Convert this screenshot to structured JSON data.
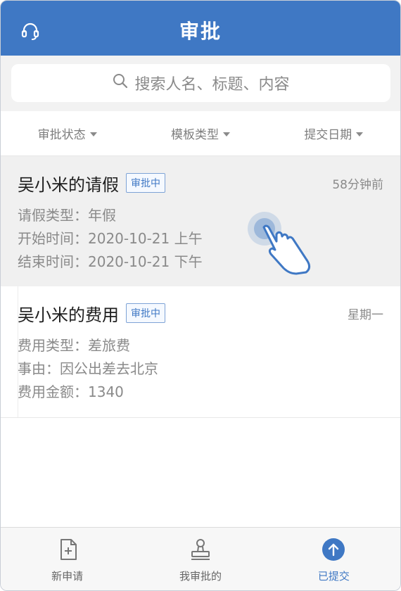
{
  "header": {
    "title": "审批",
    "support_icon": "headset-icon"
  },
  "search": {
    "placeholder": "搜索人名、标题、内容"
  },
  "filters": [
    {
      "label": "审批状态"
    },
    {
      "label": "模板类型"
    },
    {
      "label": "提交日期"
    }
  ],
  "cards": [
    {
      "title": "吴小米的请假",
      "badge": "审批中",
      "time": "58分钟前",
      "lines": [
        "请假类型：年假",
        "开始时间：2020-10-21 上午",
        "结束时间：2020-10-21 下午"
      ]
    },
    {
      "title": "吴小米的费用",
      "badge": "审批中",
      "time": "星期一",
      "lines": [
        "费用类型：差旅费",
        "事由：因公出差去北京",
        "费用金额：1340"
      ]
    }
  ],
  "tabs": [
    {
      "label": "新申请",
      "icon": "new-doc-icon",
      "active": false
    },
    {
      "label": "我审批的",
      "icon": "stamp-icon",
      "active": false
    },
    {
      "label": "已提交",
      "icon": "submitted-arrow-icon",
      "active": true
    }
  ],
  "colors": {
    "accent": "#3f78c4",
    "text_muted": "#8a8a8a",
    "bg_light": "#f2f2f2"
  }
}
